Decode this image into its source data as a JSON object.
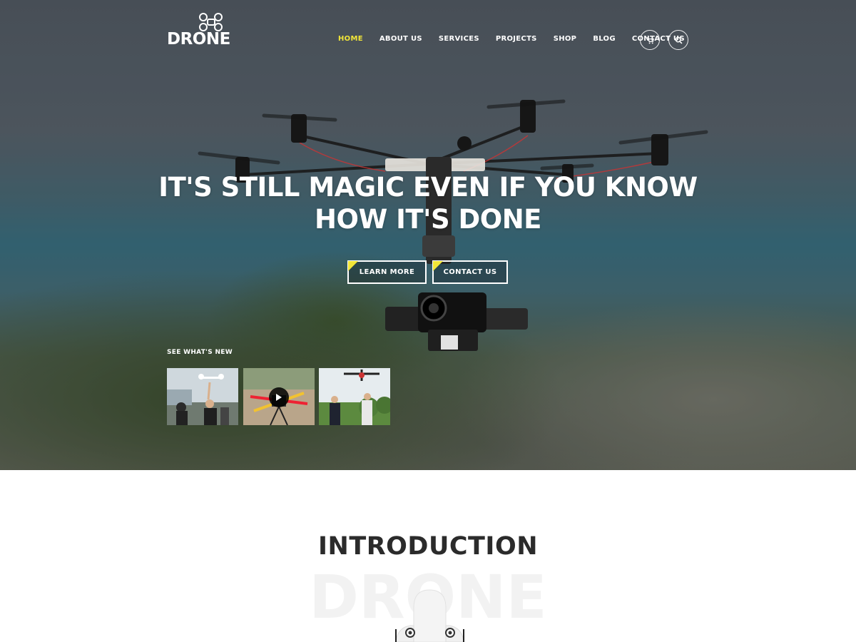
{
  "brand": {
    "name": "DRONE",
    "logo_icon": "quadcopter-logo-icon"
  },
  "nav": {
    "items": [
      {
        "label": "HOME",
        "active": true
      },
      {
        "label": "ABOUT US",
        "active": false
      },
      {
        "label": "SERVICES",
        "active": false
      },
      {
        "label": "PROJECTS",
        "active": false
      },
      {
        "label": "SHOP",
        "active": false
      },
      {
        "label": "BLOG",
        "active": false
      },
      {
        "label": "CONTACT US",
        "active": false
      }
    ],
    "cart_icon": "cart-icon",
    "search_icon": "search-icon"
  },
  "hero": {
    "headline_line1": "IT'S STILL MAGIC EVEN IF YOU KNOW",
    "headline_line2": "HOW IT'S DONE",
    "learn_more_label": "LEARN MORE",
    "contact_label": "CONTACT US"
  },
  "whats_new": {
    "label": "SEE WHAT'S NEW",
    "thumbnails": [
      {
        "name": "people-launching-drone",
        "video": false
      },
      {
        "name": "drone-on-grass-video",
        "video": true
      },
      {
        "name": "pilots-with-controllers",
        "video": false
      }
    ]
  },
  "intro": {
    "title": "INTRODUCTION",
    "watermark": "DRONE"
  },
  "colors": {
    "accent": "#f2e638",
    "text_dark": "#2b2b2b",
    "white": "#ffffff"
  }
}
